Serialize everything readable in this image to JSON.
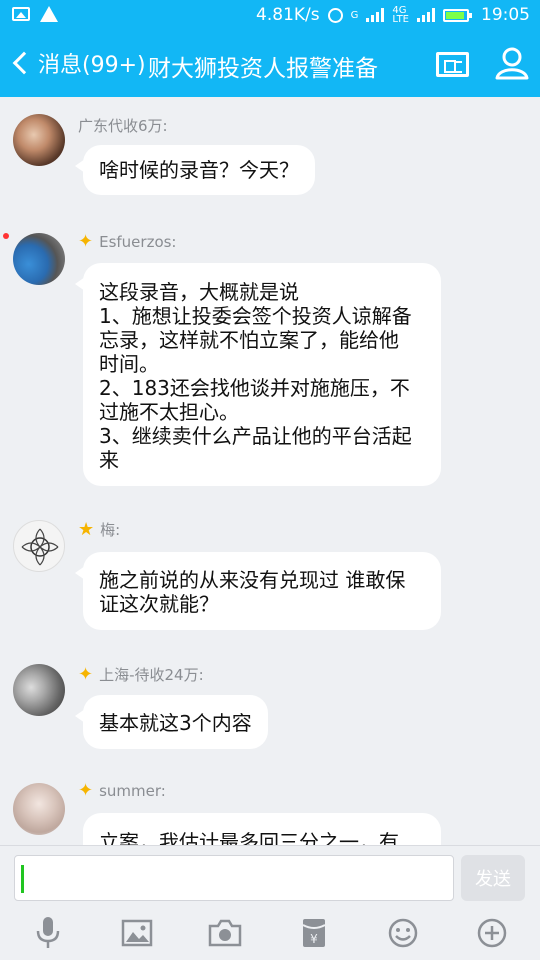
{
  "status_bar": {
    "speed": "4.81K/s",
    "net_g": "G",
    "net_4g": "4G",
    "net_lte": "LTE",
    "time": "19:05"
  },
  "header": {
    "back_label": "消息(99+)",
    "title": "财大狮投资人报警准备"
  },
  "messages": [
    {
      "sender": "广东代收6万:",
      "text": "啥时候的录音？今天？",
      "starred": false
    },
    {
      "sender": "Esfuerzos:",
      "text_lines": [
        "这段录音，大概就是说",
        "1、施想让投委会签个投资人谅解备",
        "忘录，这样就不怕立案了，能给他",
        "时间。",
        "2、183还会找他谈并对施施压，不",
        "过施不太担心。",
        "3、继续卖什么产品让他的平台活起",
        "来"
      ],
      "starred": true
    },
    {
      "sender": "梅:",
      "text_lines": [
        "施之前说的从来没有兑现过 谁敢保",
        "证这次就能？"
      ],
      "starred": true
    },
    {
      "sender": "上海-待收24万:",
      "text": "基本就这3个内容",
      "starred": true
    },
    {
      "sender": "summer:",
      "text": "立案，我估计最多回三分之一，有",
      "starred": true
    }
  ],
  "input": {
    "value": "",
    "send_label": "发送"
  },
  "toolbar": {
    "icons": [
      "microphone-icon",
      "image-icon",
      "camera-icon",
      "red-packet-icon",
      "emoji-icon",
      "plus-icon"
    ]
  },
  "colors": {
    "brand": "#12b7f5",
    "star": "#f6b400",
    "caret": "#21c521"
  }
}
